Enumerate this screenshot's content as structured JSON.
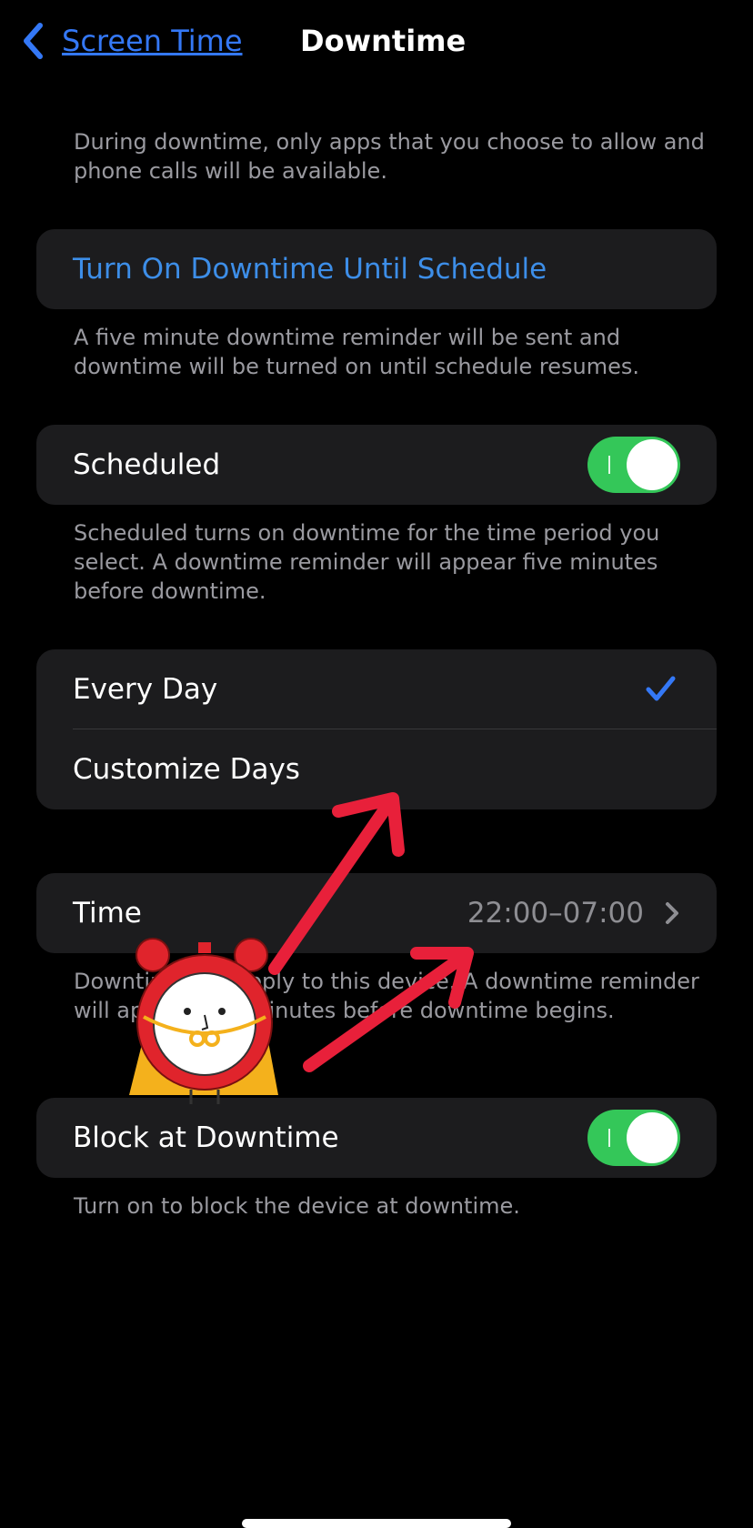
{
  "nav": {
    "back_label": "Screen Time",
    "title": "Downtime"
  },
  "intro_text": "During downtime, only apps that you choose to allow and phone calls will be available.",
  "turn_on": {
    "label": "Turn On Downtime Until Schedule",
    "footer": "A five minute downtime reminder will be sent and downtime will be turned on until schedule resumes."
  },
  "scheduled": {
    "label": "Scheduled",
    "on": true,
    "footer": "Scheduled turns on downtime for the time period you select. A downtime reminder will appear five minutes before downtime."
  },
  "days": {
    "options": [
      "Every Day",
      "Customize Days"
    ],
    "selected": "Every Day"
  },
  "time": {
    "label": "Time",
    "value": "22:00–07:00",
    "footer": "Downtime will apply to this device. A downtime reminder will appear five minutes before downtime begins."
  },
  "block": {
    "label": "Block at Downtime",
    "on": true,
    "footer": "Turn on to block the device at downtime."
  },
  "colors": {
    "accent": "#3478f6",
    "toggle_on": "#34c759",
    "annotation_arrow": "#e8203a"
  }
}
